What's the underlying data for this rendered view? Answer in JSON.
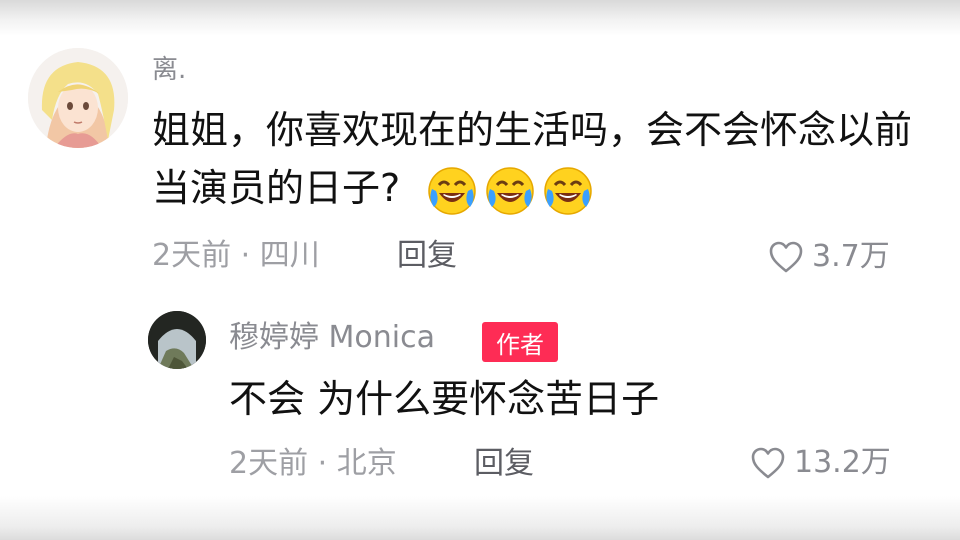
{
  "comment": {
    "username": "离.",
    "text_line1": "姐姐，你喜欢现在的生活吗，会不会怀念以前",
    "text_line2": "当演员的日子?",
    "emojis": [
      "laughing-crying-emoji",
      "laughing-crying-emoji",
      "laughing-crying-emoji"
    ],
    "time_location": "2天前 · 四川",
    "reply_label": "回复",
    "like_count": "3.7万"
  },
  "reply": {
    "username": "穆婷婷 Monica",
    "badge": "作者",
    "text": "不会 为什么要怀念苦日子",
    "time_location": "2天前 · 北京",
    "reply_label": "回复",
    "like_count": "13.2万"
  },
  "colors": {
    "badge_bg": "#fe2c55",
    "meta_text": "#9e9fa4",
    "username_text": "#8a8b91",
    "emoji_yellow": "#ffd21f",
    "emoji_tear": "#3aa0ff"
  }
}
